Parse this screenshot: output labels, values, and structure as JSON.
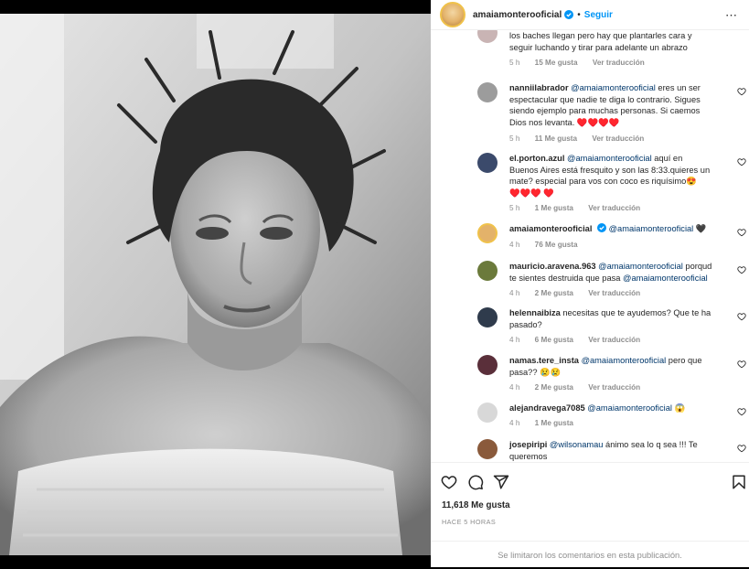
{
  "header": {
    "username": "amaiamontero​oficial",
    "separator": "•",
    "follow_label": "Seguir",
    "more_label": "⋯"
  },
  "comments": [
    {
      "user": "",
      "text": "los baches llegan pero hay que plantarles cara y seguir luchando y tirar para adelante un abrazo",
      "time": "5 h",
      "likes": "15 Me gusta",
      "translate": "Ver traducción",
      "avatar_color": "#c9b4b4"
    },
    {
      "user": "nanniilabrador",
      "mention": "@amaiamonterooficial",
      "text": " eres un ser espectacular que nadie te diga lo contrario. Sigues siendo ejemplo para muchas personas. Si caemos Dios nos levanta. ♥️♥️♥️♥️",
      "time": "5 h",
      "likes": "11 Me gusta",
      "translate": "Ver traducción",
      "avatar_color": "#9c9c9c"
    },
    {
      "user": "el.porton.azul",
      "mention": "@amaiamonterooficial",
      "text": " aquí en Buenos Aires está fresquito y son las 8:33.quieres un mate? especial para vos con coco es riquísimo😍♥️♥️♥️ ♥️",
      "time": "5 h",
      "likes": "1 Me gusta",
      "translate": "Ver traducción",
      "avatar_color": "#3b4a6b"
    },
    {
      "user": "amaiamonterooficial",
      "mention": "@amaiamonterooficial",
      "text": " 🖤",
      "time": "4 h",
      "likes": "76 Me gusta",
      "translate": "",
      "avatar_color": "#e3b26a"
    },
    {
      "user": "mauricio.aravena.963",
      "mention": "@amaiamonterooficial",
      "text": " porqud te sientes destruida que pasa ",
      "mention2": "@amaiamonterooficial",
      "time": "4 h",
      "likes": "2 Me gusta",
      "translate": "Ver traducción",
      "avatar_color": "#6b7a3b"
    },
    {
      "user": "helennaibiza",
      "mention": "",
      "text": "necesitas que te ayudemos? Que te ha pasado?",
      "time": "4 h",
      "likes": "6 Me gusta",
      "translate": "Ver traducción",
      "avatar_color": "#2f3b4c"
    },
    {
      "user": "namas.tere_insta",
      "mention": "@amaiamonterooficial",
      "text": " pero que pasa?? 😢😢",
      "time": "4 h",
      "likes": "2 Me gusta",
      "translate": "Ver traducción",
      "avatar_color": "#5a2f3a"
    },
    {
      "user": "alejandravega7085",
      "mention": "@amaiamonterooficial",
      "text": " 😱",
      "time": "4 h",
      "likes": "1 Me gusta",
      "translate": "",
      "avatar_color": "#d8d8d8"
    },
    {
      "user": "josepiripi",
      "mention": "@wilsonamau",
      "text": " ánimo sea lo q sea !!! Te queremos",
      "time": "",
      "likes": "",
      "translate": "",
      "avatar_color": "#8a5a3b"
    }
  ],
  "actions": {
    "likes": "11,618 Me gusta",
    "time_ago": "HACE 5 HORAS",
    "comments_limited": "Se limitaron los comentarios en esta publicación."
  },
  "icons": {
    "verified": "verified-badge-icon",
    "like": "heart-icon",
    "comment": "comment-bubble-icon",
    "share": "paper-plane-icon",
    "save": "bookmark-icon"
  },
  "colors": {
    "accent": "#0095f6",
    "mention": "#00376b",
    "muted": "#8e8e8e",
    "heart": "#ed4956"
  }
}
